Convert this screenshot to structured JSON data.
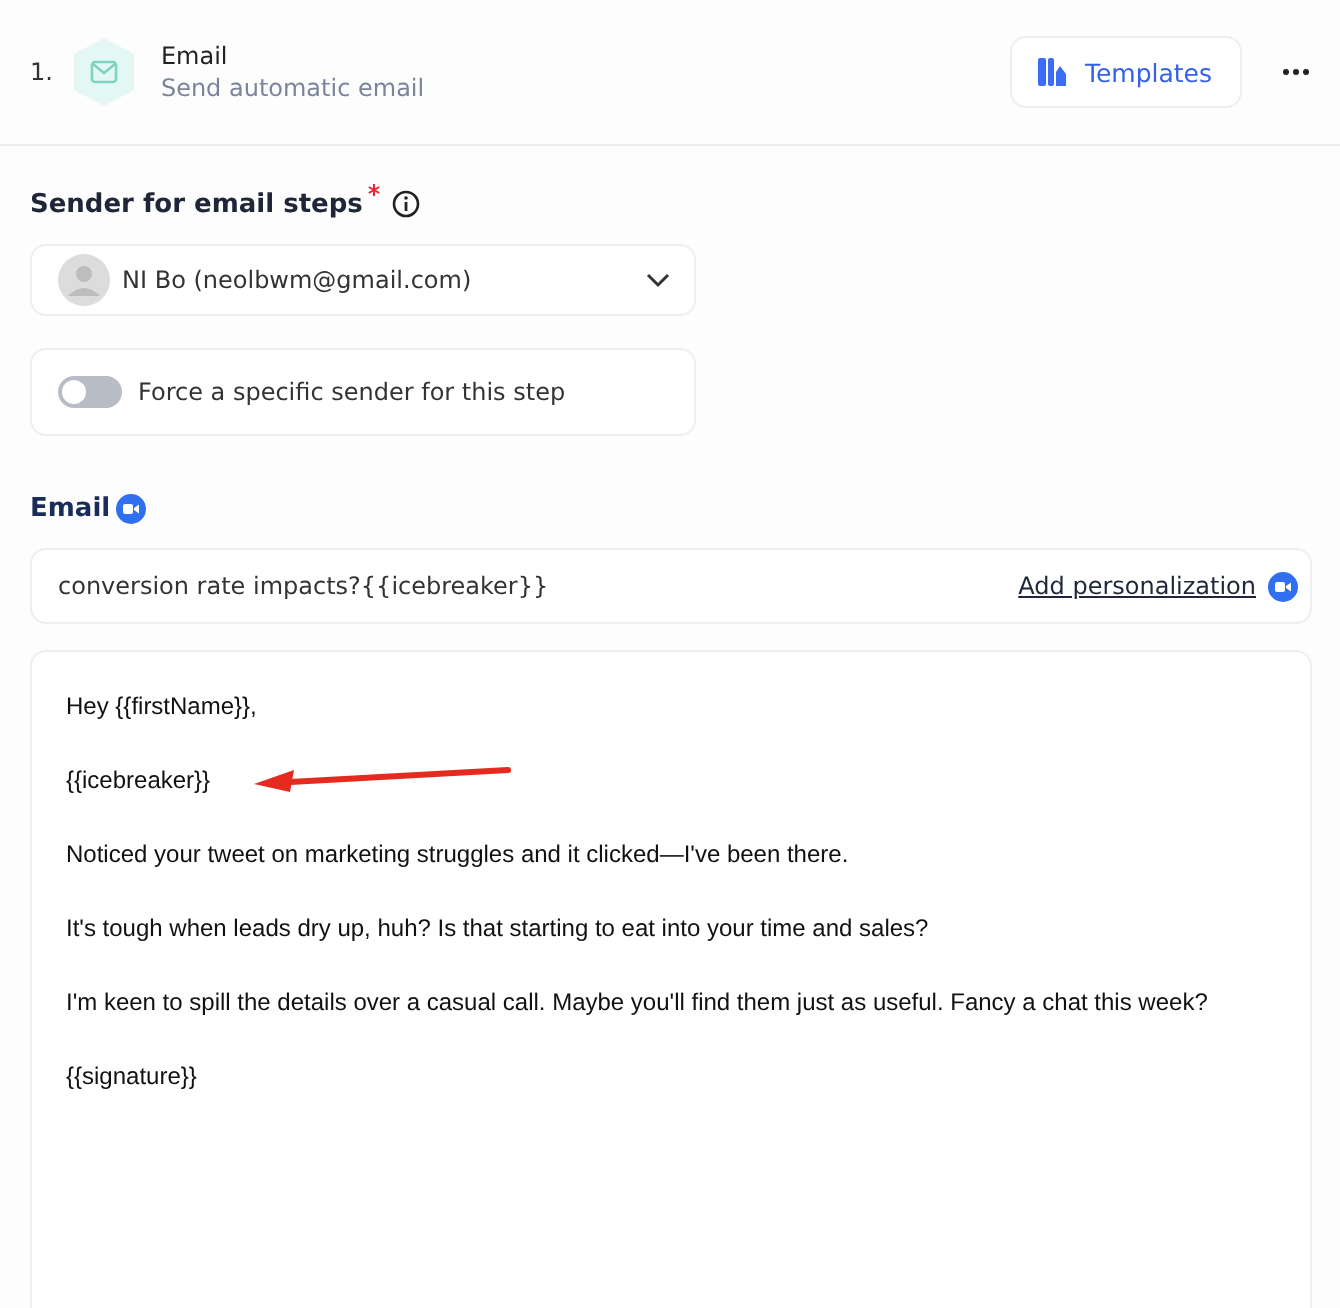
{
  "step": {
    "number": "1.",
    "title": "Email",
    "subtitle": "Send automatic email"
  },
  "templates_button": "Templates",
  "sender": {
    "label": "Sender for email steps",
    "required": true,
    "value": "NI Bo (neolbwm@gmail.com)"
  },
  "force_toggle": {
    "label": "Force a specific sender for this step",
    "on": false
  },
  "email": {
    "label": "Email",
    "subject": "conversion rate impacts?{{icebreaker}}",
    "add_personalization": "Add personalization"
  },
  "body": [
    {
      "text": "Hey {{firstName}},",
      "arrow_pointing": false
    },
    {
      "text": "{{icebreaker}}",
      "arrow_pointing": true
    },
    {
      "text": "Noticed your tweet on marketing struggles and it clicked—I've been there.",
      "arrow_pointing": false
    },
    {
      "text": "It's tough when leads dry up, huh? Is that starting to eat into your time and sales?",
      "arrow_pointing": false
    },
    {
      "text": "I'm keen to spill the details over a casual call. Maybe you'll find them just as useful. Fancy a chat this week?",
      "arrow_pointing": false
    },
    {
      "text": "{{signature}}",
      "arrow_pointing": false
    }
  ]
}
